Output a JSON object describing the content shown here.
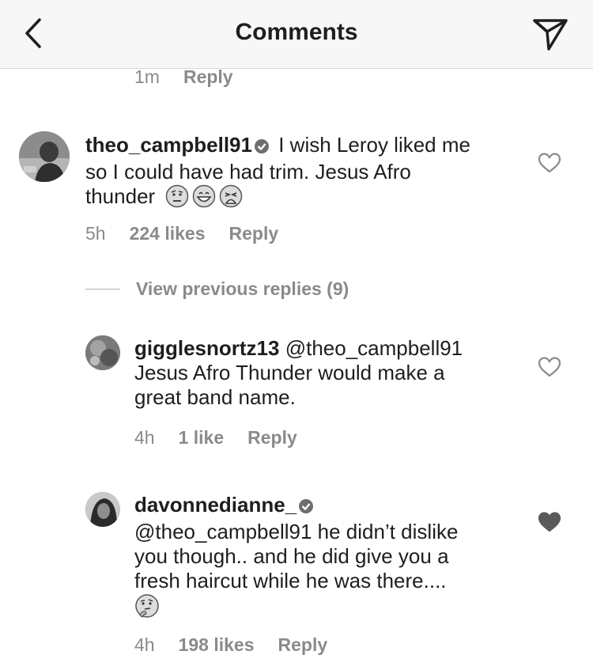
{
  "header": {
    "title": "Comments"
  },
  "top_meta": {
    "time": "1m",
    "reply": "Reply"
  },
  "comments": [
    {
      "username": "theo_campbell91",
      "text_line1": "I wish Leroy liked me",
      "text_line2": "so I could have had trim. Jesus Afro",
      "text_line3": "thunder",
      "time": "5h",
      "likes": "224 likes",
      "reply": "Reply",
      "liked": false
    }
  ],
  "view_previous": "View previous replies (9)",
  "replies": [
    {
      "username": "gigglesnortz13",
      "mention": "@theo_campbell91",
      "text_line2": "Jesus Afro Thunder would make a",
      "text_line3": "great band name.",
      "time": "4h",
      "likes": "1 like",
      "reply": "Reply",
      "liked": false
    },
    {
      "username": "davonnedianne_",
      "text_line2": "@theo_campbell91 he didn’t dislike",
      "text_line3": "you though.. and he did give you a",
      "text_line4": "fresh haircut while he was there....",
      "time": "4h",
      "likes": "198 likes",
      "reply": "Reply",
      "liked": true
    }
  ],
  "icons": {
    "back": "chevron-left-icon",
    "send": "paper-plane-icon",
    "verified": "verified-badge-icon",
    "heart": "heart-icon"
  },
  "colors": {
    "text": "#1e1e1e",
    "meta": "#8a8a8a",
    "header_bg": "#f7f7f7"
  }
}
